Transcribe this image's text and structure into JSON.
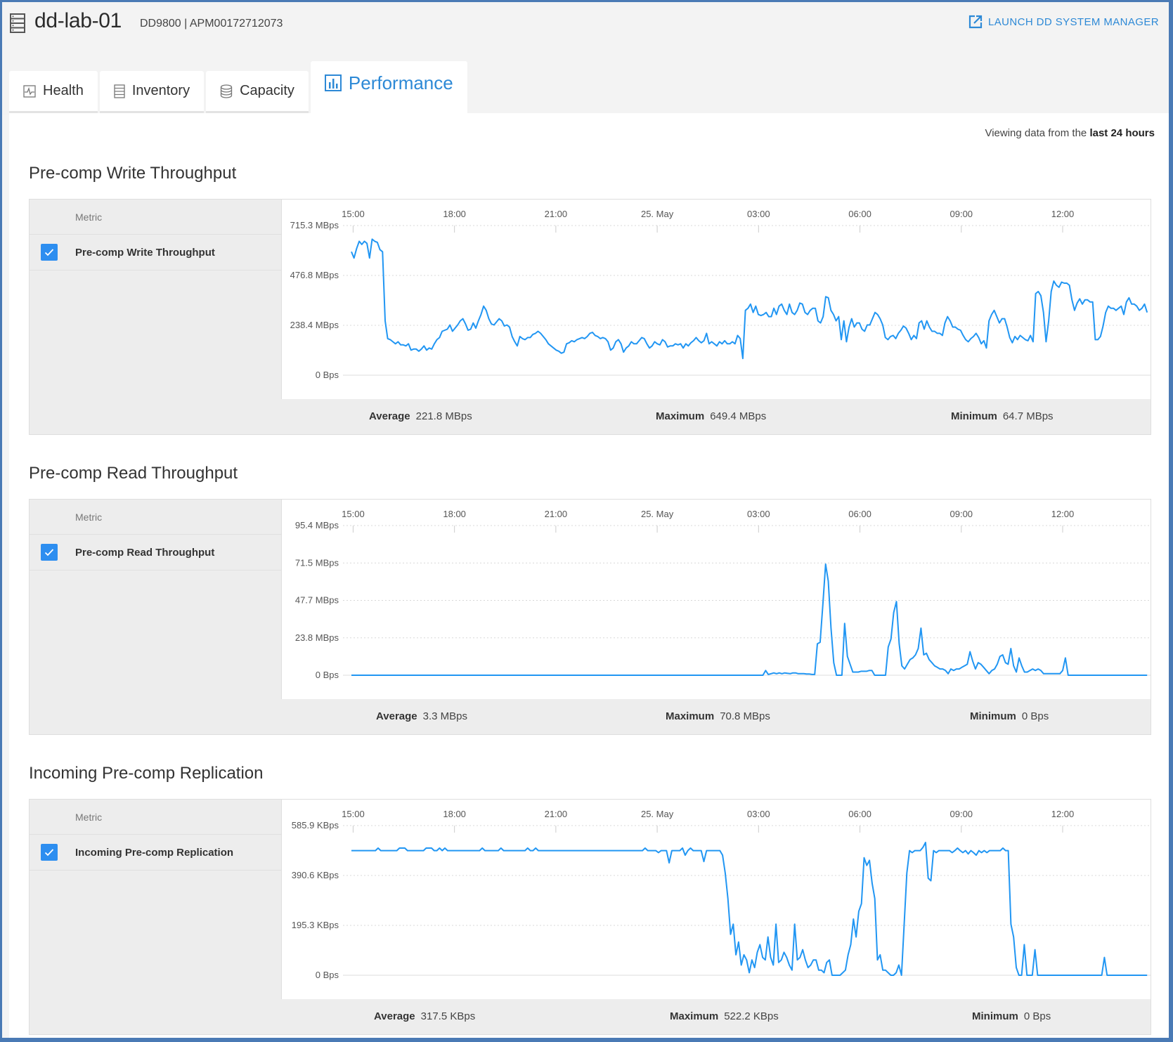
{
  "header": {
    "title": "dd-lab-01",
    "subtitle": "DD9800 | APM00172712073",
    "launch_label": "LAUNCH DD SYSTEM MANAGER",
    "icon": "server-icon"
  },
  "tabs": [
    {
      "label": "Health",
      "icon": "health-pulse-icon",
      "active": false
    },
    {
      "label": "Inventory",
      "icon": "inventory-list-icon",
      "active": false
    },
    {
      "label": "Capacity",
      "icon": "database-icon",
      "active": false
    },
    {
      "label": "Performance",
      "icon": "bar-chart-icon",
      "active": true
    }
  ],
  "viewing": {
    "prefix": "Viewing data from the ",
    "range": "last 24 hours"
  },
  "colors": {
    "accent": "#2d89d6",
    "line": "#2196f3",
    "checkbox": "#2d8ef0"
  },
  "metric_header": "Metric",
  "chart_data": [
    {
      "type": "line",
      "title": "Pre-comp Write Throughput",
      "metric_label": "Pre-comp Write Throughput",
      "checked": true,
      "unit": "MBps",
      "x_ticks": [
        "15:00",
        "18:00",
        "21:00",
        "25. May",
        "03:00",
        "06:00",
        "09:00",
        "12:00"
      ],
      "x_range_hours": [
        -0.3,
        23.6
      ],
      "y_ticks": [
        "0 Bps",
        "238.4 MBps",
        "476.8 MBps",
        "715.3 MBps"
      ],
      "ylim": [
        0,
        715.3
      ],
      "grid": true,
      "stats": {
        "average": "221.8 MBps",
        "maximum": "649.4 MBps",
        "minimum": "64.7 MBps"
      },
      "series": [
        {
          "name": "Pre-comp Write Throughput",
          "values": [
            590,
            560,
            605,
            640,
            625,
            640,
            630,
            560,
            650,
            640,
            635,
            600,
            590,
            260,
            175,
            170,
            160,
            150,
            160,
            145,
            145,
            140,
            150,
            120,
            125,
            125,
            115,
            125,
            140,
            120,
            130,
            125,
            150,
            170,
            180,
            210,
            215,
            220,
            240,
            210,
            225,
            240,
            260,
            270,
            245,
            215,
            220,
            250,
            225,
            260,
            290,
            330,
            310,
            270,
            245,
            240,
            255,
            270,
            260,
            235,
            240,
            230,
            185,
            160,
            140,
            185,
            175,
            170,
            180,
            180,
            195,
            200,
            210,
            200,
            185,
            170,
            150,
            140,
            130,
            120,
            115,
            105,
            110,
            150,
            155,
            165,
            160,
            170,
            175,
            180,
            175,
            185,
            200,
            205,
            190,
            185,
            175,
            180,
            175,
            160,
            120,
            130,
            160,
            170,
            150,
            110,
            130,
            140,
            160,
            150,
            150,
            165,
            180,
            175,
            150,
            130,
            140,
            160,
            150,
            145,
            170,
            160,
            135,
            140,
            140,
            150,
            145,
            150,
            130,
            150,
            140,
            155,
            165,
            180,
            165,
            155,
            165,
            200,
            150,
            160,
            150,
            140,
            160,
            150,
            165,
            150,
            150,
            160,
            150,
            190,
            175,
            80,
            310,
            320,
            340,
            300,
            330,
            290,
            285,
            290,
            300,
            280,
            280,
            320,
            290,
            330,
            340,
            310,
            290,
            340,
            300,
            290,
            310,
            345,
            340,
            300,
            290,
            310,
            320,
            320,
            260,
            250,
            280,
            375,
            370,
            310,
            290,
            260,
            280,
            170,
            260,
            160,
            230,
            270,
            230,
            250,
            250,
            220,
            210,
            240,
            240,
            270,
            300,
            290,
            270,
            240,
            180,
            170,
            185,
            190,
            175,
            200,
            215,
            235,
            225,
            200,
            170,
            190,
            175,
            250,
            260,
            220,
            260,
            230,
            210,
            210,
            200,
            200,
            190,
            250,
            280,
            260,
            230,
            230,
            220,
            215,
            190,
            170,
            160,
            175,
            185,
            200,
            180,
            150,
            165,
            130,
            260,
            290,
            310,
            280,
            250,
            270,
            270,
            230,
            180,
            155,
            185,
            170,
            190,
            180,
            170,
            165,
            190,
            160,
            390,
            400,
            380,
            300,
            160,
            260,
            400,
            450,
            430,
            420,
            445,
            440,
            440,
            430,
            360,
            310,
            345,
            365,
            340,
            360,
            360,
            350,
            350,
            170,
            170,
            185,
            235,
            300,
            330,
            320,
            320,
            310,
            320,
            330,
            290,
            350,
            370,
            340,
            340,
            330,
            310,
            320,
            340,
            300
          ]
        }
      ]
    },
    {
      "type": "line",
      "title": "Pre-comp Read Throughput",
      "metric_label": "Pre-comp Read Throughput",
      "checked": true,
      "unit": "MBps",
      "x_ticks": [
        "15:00",
        "18:00",
        "21:00",
        "25. May",
        "03:00",
        "06:00",
        "09:00",
        "12:00"
      ],
      "x_range_hours": [
        -0.3,
        23.6
      ],
      "y_ticks": [
        "0 Bps",
        "23.8 MBps",
        "47.7 MBps",
        "71.5 MBps",
        "95.4 MBps"
      ],
      "ylim": [
        0,
        95.4
      ],
      "grid": true,
      "stats": {
        "average": "3.3 MBps",
        "maximum": "70.8 MBps",
        "minimum": "0 Bps"
      },
      "series": [
        {
          "name": "Pre-comp Read Throughput",
          "values": [
            0,
            0,
            0,
            0,
            0,
            0,
            0,
            0,
            0,
            0,
            0,
            0,
            0,
            0,
            0,
            0,
            0,
            0,
            0,
            0,
            0,
            0,
            0,
            0,
            0,
            0,
            0,
            0,
            0,
            0,
            0,
            0,
            0,
            0,
            0,
            0,
            0,
            0,
            0,
            0,
            0,
            0,
            0,
            0,
            0,
            0,
            0,
            0,
            0,
            0,
            0,
            0,
            0,
            0,
            0,
            0,
            0,
            0,
            0,
            0,
            0,
            0,
            0,
            0,
            0,
            0,
            0,
            0,
            0,
            0,
            0,
            0,
            0,
            0,
            0,
            0,
            0,
            0,
            0,
            0,
            0,
            0,
            0,
            0,
            0,
            0,
            0,
            0,
            0,
            0,
            0,
            0,
            0,
            0,
            0,
            0,
            0,
            0,
            0,
            0,
            0,
            0,
            0,
            0,
            0,
            0,
            0,
            0,
            0,
            0,
            0,
            0,
            0,
            0,
            0,
            0,
            0,
            0,
            0,
            0,
            0,
            0,
            0,
            0,
            0,
            0,
            0,
            0,
            0,
            0,
            0,
            0,
            0,
            0,
            0,
            0,
            0,
            0,
            0,
            0,
            0,
            0,
            0,
            0,
            0,
            0,
            0,
            0,
            0,
            0,
            0,
            0,
            3,
            0.5,
            1,
            1.5,
            1,
            1.5,
            1,
            1.5,
            1.2,
            1,
            1.5,
            1.5,
            1,
            1,
            1,
            0.8,
            0.8,
            0.5,
            0.5,
            20,
            21,
            45,
            70.8,
            60,
            30,
            8,
            0,
            0,
            0,
            33,
            12,
            7,
            2,
            2,
            2,
            2.5,
            2.5,
            2.5,
            3,
            3,
            0,
            0,
            0,
            0,
            0,
            18,
            23,
            40,
            47,
            20,
            6,
            4,
            7,
            10,
            11,
            13,
            17,
            30,
            13,
            14,
            10,
            8,
            6,
            5,
            4,
            4,
            3,
            1,
            4,
            3,
            4,
            4,
            5,
            6,
            7,
            15,
            9,
            4,
            8,
            7,
            5,
            3,
            1,
            3,
            4,
            7,
            12,
            13,
            8,
            7,
            17,
            6,
            2,
            11,
            6,
            2,
            2,
            3,
            4,
            3,
            4,
            3,
            1,
            1,
            1,
            1,
            1,
            1,
            1,
            3,
            11,
            0,
            0,
            0,
            0,
            0,
            0,
            0,
            0,
            0,
            0,
            0,
            0,
            0,
            0,
            0,
            0,
            0,
            0,
            0,
            0,
            0,
            0,
            0,
            0,
            0,
            0,
            0,
            0,
            0,
            0
          ]
        }
      ]
    },
    {
      "type": "line",
      "title": "Incoming Pre-comp Replication",
      "metric_label": "Incoming Pre-comp Replication",
      "checked": true,
      "unit": "KBps",
      "x_ticks": [
        "15:00",
        "18:00",
        "21:00",
        "25. May",
        "03:00",
        "06:00",
        "09:00",
        "12:00"
      ],
      "x_range_hours": [
        -0.3,
        23.6
      ],
      "y_ticks": [
        "0 Bps",
        "195.3 KBps",
        "390.6 KBps",
        "585.9 KBps"
      ],
      "ylim": [
        0,
        585.9
      ],
      "grid": true,
      "stats": {
        "average": "317.5 KBps",
        "maximum": "522.2 KBps",
        "minimum": "0 Bps"
      },
      "series": [
        {
          "name": "Incoming Pre-comp Replication",
          "values": [
            488,
            488,
            488,
            488,
            488,
            488,
            488,
            488,
            488,
            488,
            498,
            488,
            488,
            488,
            488,
            488,
            488,
            488,
            498,
            498,
            498,
            488,
            488,
            488,
            488,
            488,
            488,
            488,
            498,
            498,
            498,
            488,
            488,
            498,
            488,
            498,
            488,
            488,
            488,
            488,
            488,
            488,
            488,
            488,
            488,
            488,
            488,
            488,
            488,
            498,
            488,
            488,
            488,
            488,
            488,
            488,
            498,
            488,
            488,
            488,
            488,
            488,
            488,
            488,
            488,
            488,
            498,
            488,
            488,
            498,
            488,
            488,
            488,
            488,
            488,
            488,
            488,
            488,
            488,
            488,
            488,
            488,
            488,
            488,
            488,
            488,
            488,
            488,
            488,
            488,
            488,
            488,
            488,
            488,
            488,
            488,
            488,
            488,
            488,
            488,
            488,
            488,
            488,
            488,
            488,
            488,
            488,
            488,
            488,
            488,
            498,
            488,
            488,
            488,
            488,
            480,
            488,
            488,
            488,
            440,
            488,
            488,
            488,
            488,
            498,
            470,
            488,
            498,
            488,
            488,
            488,
            488,
            445,
            488,
            488,
            488,
            488,
            488,
            488,
            470,
            400,
            300,
            160,
            200,
            80,
            130,
            40,
            80,
            60,
            10,
            60,
            30,
            90,
            120,
            70,
            60,
            150,
            70,
            40,
            200,
            50,
            60,
            90,
            70,
            40,
            20,
            200,
            60,
            70,
            100,
            60,
            30,
            40,
            60,
            60,
            20,
            20,
            10,
            50,
            60,
            0,
            0,
            0,
            0,
            10,
            20,
            80,
            120,
            220,
            150,
            250,
            280,
            460,
            430,
            450,
            360,
            300,
            60,
            80,
            20,
            20,
            10,
            0,
            0,
            10,
            40,
            0,
            200,
            400,
            488,
            480,
            488,
            488,
            488,
            500,
            520,
            380,
            370,
            488,
            480,
            488,
            488,
            488,
            488,
            488,
            480,
            488,
            498,
            488,
            480,
            488,
            475,
            488,
            480,
            470,
            488,
            480,
            488,
            480,
            488,
            488,
            488,
            488,
            488,
            498,
            488,
            488,
            200,
            150,
            30,
            0,
            0,
            120,
            0,
            0,
            0,
            100,
            0,
            0,
            0,
            0,
            0,
            0,
            0,
            0,
            0,
            0,
            0,
            0,
            0,
            0,
            0,
            0,
            0,
            0,
            0,
            0,
            0,
            0,
            0,
            0,
            0,
            70,
            0,
            0,
            0,
            0,
            0,
            0,
            0,
            0,
            0,
            0,
            0,
            0,
            0,
            0,
            0,
            0
          ]
        }
      ]
    }
  ],
  "stat_labels": {
    "average": "Average",
    "maximum": "Maximum",
    "minimum": "Minimum"
  }
}
